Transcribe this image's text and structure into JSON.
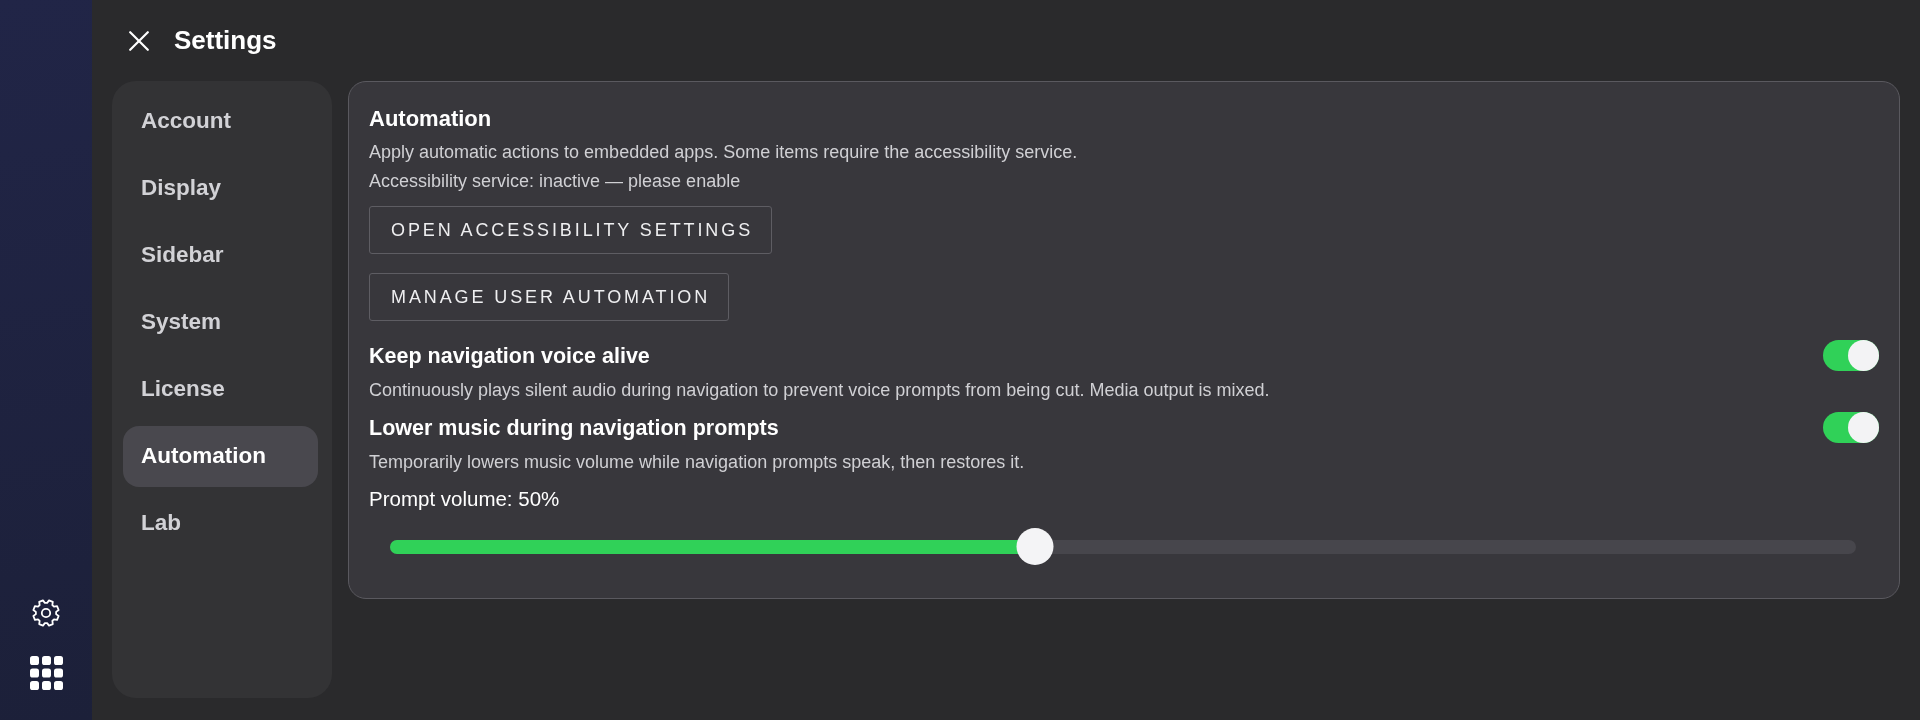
{
  "header": {
    "title": "Settings"
  },
  "sidebar": {
    "items": [
      {
        "label": "Account",
        "selected": false
      },
      {
        "label": "Display",
        "selected": false
      },
      {
        "label": "Sidebar",
        "selected": false
      },
      {
        "label": "System",
        "selected": false
      },
      {
        "label": "License",
        "selected": false
      },
      {
        "label": "Automation",
        "selected": true
      },
      {
        "label": "Lab",
        "selected": false
      }
    ]
  },
  "panel": {
    "title": "Automation",
    "description": "Apply automatic actions to embedded apps. Some items require the accessibility service.",
    "status": "Accessibility service: inactive — please enable",
    "buttons": [
      "OPEN ACCESSIBILITY SETTINGS",
      "MANAGE USER AUTOMATION"
    ],
    "settings": [
      {
        "kind": "toggle",
        "title": "Keep navigation voice alive",
        "description": "Continuously plays silent audio during navigation to prevent voice prompts from being cut. Media output is mixed.",
        "on": true
      },
      {
        "kind": "toggle",
        "title": "Lower music during navigation prompts",
        "description": "Temporarily lowers music volume while navigation prompts speak, then restores it.",
        "on": true
      },
      {
        "kind": "slider",
        "label": "Prompt volume: 50%",
        "level": 0.44
      }
    ]
  }
}
